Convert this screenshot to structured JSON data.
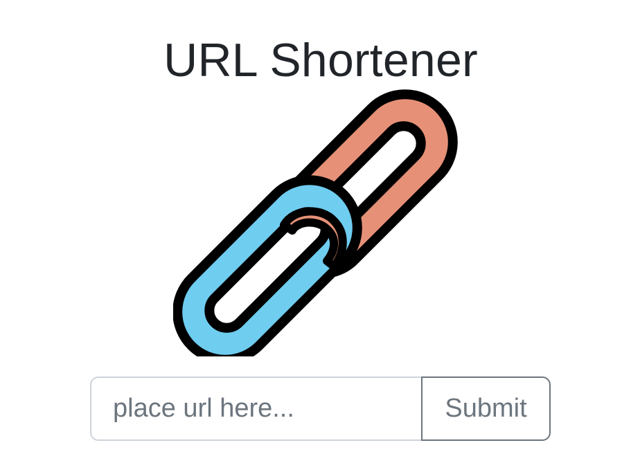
{
  "header": {
    "title": "URL Shortener"
  },
  "logo": {
    "icon": "chain-link-icon",
    "colors": {
      "link_back": "#e69177",
      "link_front": "#6fcdf0",
      "outline": "#000000"
    }
  },
  "form": {
    "url_input": {
      "value": "",
      "placeholder": "place url here..."
    },
    "submit_label": "Submit"
  }
}
